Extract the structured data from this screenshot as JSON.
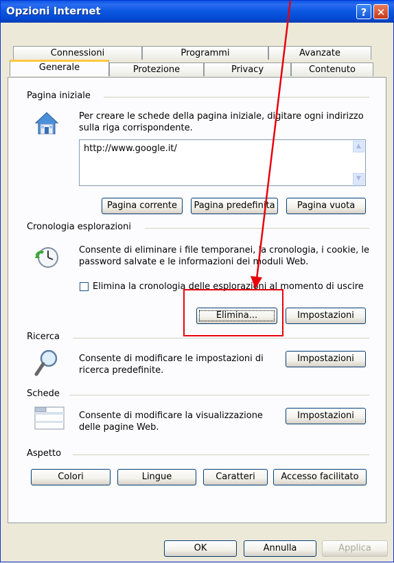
{
  "window": {
    "title": "Opzioni Internet"
  },
  "titlebar": {
    "help_glyph": "?",
    "close_glyph": "✕"
  },
  "tabs": {
    "row1": [
      "Connessioni",
      "Programmi",
      "Avanzate"
    ],
    "row2": [
      "Generale",
      "Protezione",
      "Privacy",
      "Contenuto"
    ],
    "active": "Generale"
  },
  "home": {
    "group_label": "Pagina iniziale",
    "description_line1": "Per creare le schede della pagina iniziale, digitare ogni indirizzo",
    "description_line2": "sulla riga corrispondente.",
    "url_value": "http://www.google.it/",
    "buttons": {
      "current": "Pagina corrente",
      "default": "Pagina predefinita",
      "blank": "Pagina vuota"
    }
  },
  "history": {
    "group_label": "Cronologia esplorazioni",
    "description_line1": "Consente di eliminare i file temporanei, la cronologia, i cookie, le",
    "description_line2": "password salvate e le informazioni dei moduli Web.",
    "checkbox_label": "Elimina la cronologia delle esplorazioni al momento di uscire",
    "checkbox_checked": false,
    "buttons": {
      "delete": "Elimina...",
      "settings": "Impostazioni"
    }
  },
  "search": {
    "group_label": "Ricerca",
    "description_line1": "Consente di modificare le impostazioni di",
    "description_line2": "ricerca predefinite.",
    "settings": "Impostazioni"
  },
  "tabs_group": {
    "group_label": "Schede",
    "description_line1": "Consente di modificare la visualizzazione",
    "description_line2": "delle pagine Web.",
    "settings": "Impostazioni"
  },
  "appearance": {
    "group_label": "Aspetto",
    "buttons": {
      "colors": "Colori",
      "languages": "Lingue",
      "fonts": "Caratteri",
      "accessibility": "Accesso facilitato"
    }
  },
  "footer": {
    "ok": "OK",
    "cancel": "Annulla",
    "apply": "Applica"
  },
  "annotation": {
    "color": "#e8000b"
  }
}
